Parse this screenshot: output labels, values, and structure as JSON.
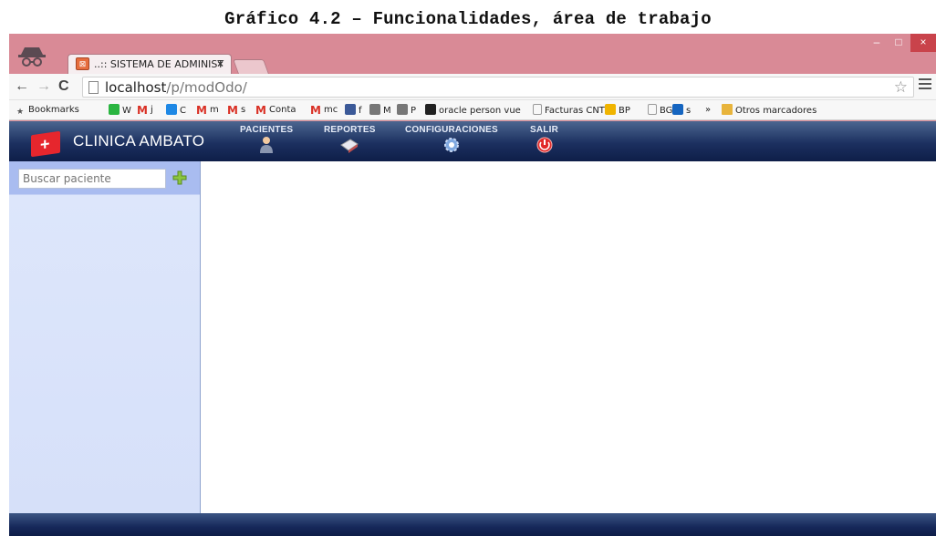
{
  "caption": "Gráfico 4.2 – Funcionalidades, área de trabajo",
  "browser": {
    "tab_title": "..:: SISTEMA DE ADMINIST",
    "tab_close": "×",
    "url_host": "localhost",
    "url_path": "/p/modOdo/",
    "window_controls": {
      "minimize": "–",
      "maximize": "□",
      "close": "×"
    },
    "bookmarks": [
      {
        "label": "Bookmarks",
        "icon": "star-icon",
        "color": "#555555"
      },
      {
        "label": "W",
        "icon": "whatsapp-icon",
        "color": "#2ab540"
      },
      {
        "label": "j",
        "icon": "gmail-icon",
        "color": "#d93025"
      },
      {
        "label": "C",
        "icon": "contacts-icon",
        "color": "#1e88e5"
      },
      {
        "label": "m",
        "icon": "gmail-icon",
        "color": "#d93025"
      },
      {
        "label": "s",
        "icon": "gmail-icon",
        "color": "#d93025"
      },
      {
        "label": "Conta",
        "icon": "gmail-icon",
        "color": "#d93025"
      },
      {
        "label": "mc",
        "icon": "gmail-icon",
        "color": "#d93025"
      },
      {
        "label": "f",
        "icon": "facebook-icon",
        "color": "#3b5998"
      },
      {
        "label": "M",
        "icon": "messenger-icon",
        "color": "#777777"
      },
      {
        "label": "P",
        "icon": "messenger-icon",
        "color": "#777777"
      },
      {
        "label": "oracle person vue",
        "icon": "pearson-icon",
        "color": "#222222"
      },
      {
        "label": "Facturas CNT",
        "icon": "page-icon",
        "color": "#999999"
      },
      {
        "label": "BP",
        "icon": "bank-icon",
        "color": "#f0b400"
      },
      {
        "label": "BG",
        "icon": "page-icon",
        "color": "#999999"
      },
      {
        "label": "s",
        "icon": "app-icon",
        "color": "#1565c0"
      },
      {
        "label": "»",
        "icon": "",
        "color": ""
      },
      {
        "label": "Otros marcadores",
        "icon": "folder-icon",
        "color": "#e8b43c"
      }
    ]
  },
  "app": {
    "name": "CLINICA AMBATO",
    "menu": [
      {
        "label": "PACIENTES",
        "icon": "patient-icon"
      },
      {
        "label": "REPORTES",
        "icon": "reports-icon"
      },
      {
        "label": "CONFIGURACIONES",
        "icon": "settings-gear-icon"
      },
      {
        "label": "SALIR",
        "icon": "power-icon"
      }
    ],
    "search_placeholder": "Buscar paciente",
    "colors": {
      "header": "#1c3060",
      "sidebar": "#d6e0f9",
      "sidebar_top": "#a9bcf0",
      "logo": "#e6262d",
      "browser_frame": "#d98a96"
    }
  }
}
